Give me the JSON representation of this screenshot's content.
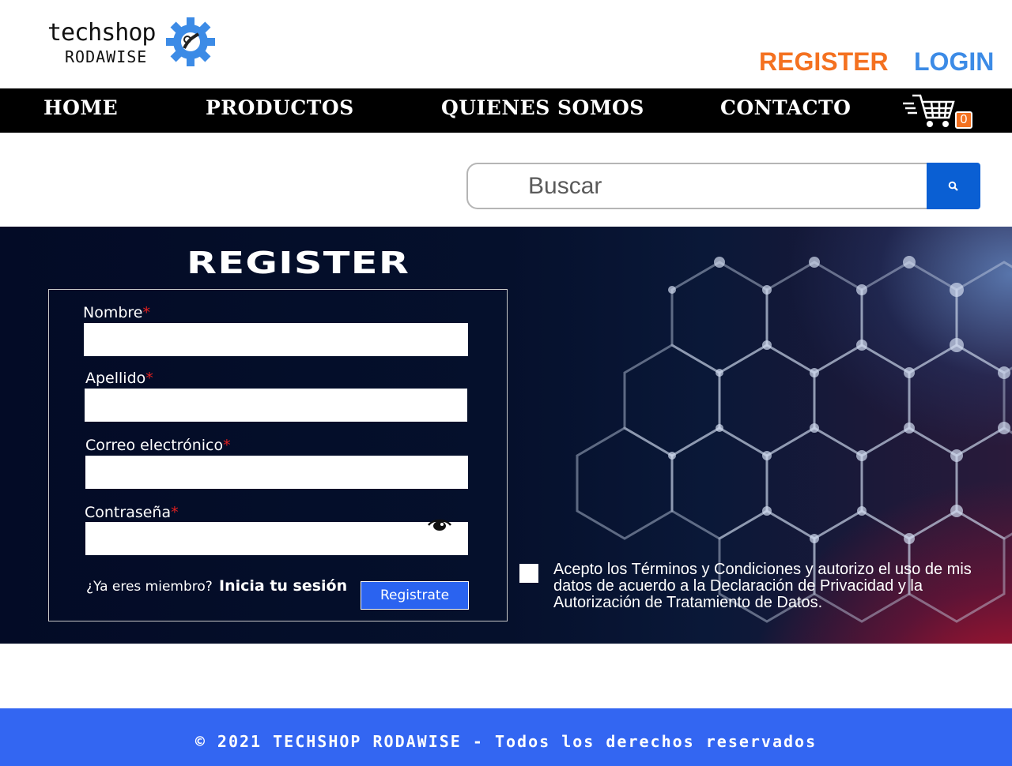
{
  "header": {
    "logo_top": "techshop",
    "logo_bottom": "RODAWISE",
    "register_label": "REGISTER",
    "login_label": "LOGIN"
  },
  "nav": {
    "items": [
      {
        "label": "HOME"
      },
      {
        "label": "PRODUCTOS"
      },
      {
        "label": "QUIENES SOMOS"
      },
      {
        "label": "CONTACTO"
      }
    ],
    "cart_count": "0"
  },
  "search": {
    "placeholder": "Buscar"
  },
  "register": {
    "title": "REGISTER",
    "fields": [
      {
        "label": "Nombre",
        "required": "*",
        "value": ""
      },
      {
        "label": "Apellido",
        "required": "*",
        "value": ""
      },
      {
        "label": "Correo electrónico",
        "required": "*",
        "value": ""
      },
      {
        "label": "Contraseña",
        "required": "*",
        "value": ""
      }
    ],
    "member_question": "¿Ya eres miembro?",
    "login_link": "Inicia tu sesión",
    "submit_label": "Registrate",
    "terms_text": "Acepto los Términos y Condiciones y autorizo el uso de mis datos de acuerdo a la Declaración de Privacidad y la Autorización de Tratamiento de Datos."
  },
  "footer": {
    "text": "© 2021 TECHSHOP RODAWISE - Todos los derechos reservados"
  },
  "colors": {
    "accent_orange": "#f47120",
    "accent_blue": "#3c8be6",
    "footer_blue": "#3366f2",
    "button_blue": "#2a63f0"
  }
}
